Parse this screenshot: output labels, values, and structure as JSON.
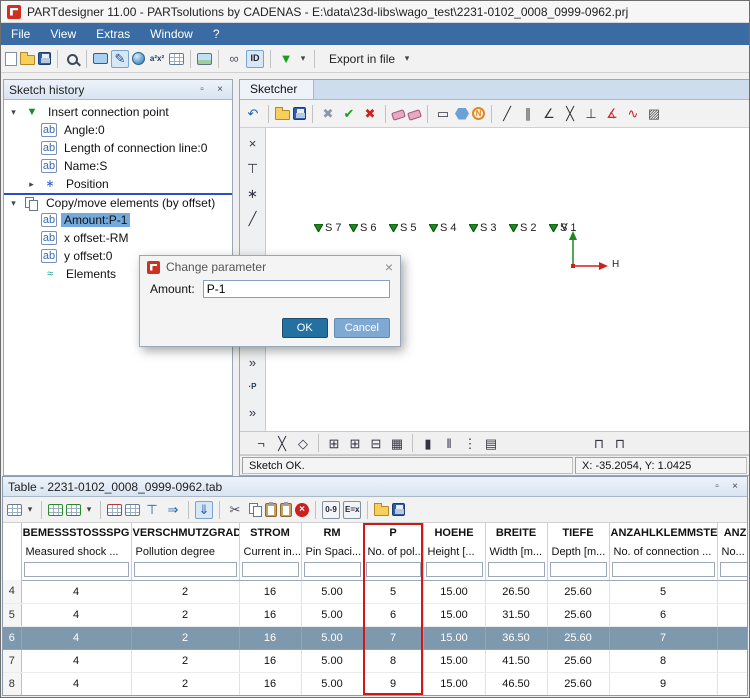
{
  "titlebar": {
    "title": "PARTdesigner 11.00 - PARTsolutions by CADENAS - E:\\data\\23d-libs\\wago_test\\2231-0102_0008_0999-0962.prj"
  },
  "menubar": {
    "items": [
      "File",
      "View",
      "Extras",
      "Window",
      "?"
    ]
  },
  "main_toolbar": {
    "icons": [
      "new-document",
      "open-project",
      "save-project",
      "|",
      "zoom-preview",
      "|",
      "copy-view",
      "sketcher-mode",
      "solid-view",
      "variable-list",
      "table-view",
      "|",
      "preview-image",
      "|",
      "link-parts",
      "id-display",
      "|",
      "status-flag",
      "dropdown-arrow",
      "|"
    ],
    "export_button": "Export in file"
  },
  "sketch_history": {
    "title": "Sketch history",
    "nodes": [
      {
        "label": "Insert connection point",
        "icon": "connection-point",
        "expanded": true,
        "children": [
          {
            "label": "Angle:0",
            "icon": "param-field"
          },
          {
            "label": "Length of connection line:0",
            "icon": "param-field"
          },
          {
            "label": "Name:S",
            "icon": "param-field"
          },
          {
            "label": "Position",
            "icon": "position-marker",
            "collapsed": true
          }
        ]
      },
      {
        "label": "Copy/move elements (by offset)",
        "icon": "copy-move",
        "expanded": true,
        "separator_above": true,
        "children": [
          {
            "label": "Amount:P-1",
            "icon": "param-field",
            "selected": true
          },
          {
            "label": "x offset:-RM",
            "icon": "param-field"
          },
          {
            "label": "y offset:0",
            "icon": "param-field"
          },
          {
            "label": "Elements",
            "icon": "elements"
          }
        ]
      }
    ]
  },
  "sketcher": {
    "title": "Sketcher",
    "toolbar_icons": [
      "undo",
      "|",
      "open-sketch",
      "save-sketch",
      "|",
      "delete-selection",
      "accept-sketch",
      "discard-sketch",
      "|",
      "eraser",
      "eraser-elements",
      "|",
      "rectangle-tool",
      "polygon-tool",
      "spline-badge",
      "|",
      "line-tool",
      "parallel-lines-tool",
      "angle-tool",
      "cross-lines-tool",
      "perpendicular-tool",
      "measure-angle-tool",
      "polyline-tool",
      "hatch-tool"
    ],
    "left_toolbar_icons": [
      "construction-point",
      "tangent-point",
      "star-point",
      "slash-line",
      "~",
      "chevron-more-1",
      "chevron-more-2",
      "point-label",
      "chevron-more-3"
    ],
    "bottom_toolbar_icons": [
      "corner-marker",
      "cross-marker",
      "diamond-marker",
      "|",
      "grid-snap",
      "grid-show",
      "grid-minor",
      "grid-fill",
      "|",
      "single-column",
      "double-column",
      "triple-column",
      "panel-grid",
      "~",
      "profile-cap-1",
      "profile-cap-2"
    ],
    "points": [
      {
        "label": "S 7"
      },
      {
        "label": "S 6"
      },
      {
        "label": "S 5"
      },
      {
        "label": "S 4"
      },
      {
        "label": "S 3"
      },
      {
        "label": "S 2"
      },
      {
        "label": "S 1"
      }
    ],
    "axes": {
      "vertical": "V",
      "horizontal": "H"
    },
    "status": {
      "message": "Sketch OK.",
      "coordinates": "X: -35.2054, Y: 1.0425"
    }
  },
  "dialog": {
    "title": "Change parameter",
    "label": "Amount:",
    "value": "P-1",
    "ok": "OK",
    "cancel": "Cancel"
  },
  "table_panel": {
    "title": "Table - 2231-0102_0008_0999-0962.tab",
    "toolbar_icons": [
      "table-edit",
      "dropdown-arrow",
      "|",
      "insert-row",
      "insert-column",
      "dropdown-arrow",
      "|",
      "delete-cells",
      "transpose-table",
      "merge-cells",
      "transfer-right",
      "|",
      "transfer-down",
      "|",
      "cut",
      "copy",
      "paste",
      "paste-special",
      "delete-rows",
      "|",
      "digit-format",
      "value-format",
      "|",
      "open-table",
      "save-table"
    ],
    "columns": [
      {
        "name": "BEMESSSTOSSSPG",
        "desc": "Measured shock ..."
      },
      {
        "name": "VERSCHMUTZGRAD",
        "desc": "Pollution degree"
      },
      {
        "name": "STROM",
        "desc": "Current in..."
      },
      {
        "name": "RM",
        "desc": "Pin Spaci..."
      },
      {
        "name": "P",
        "desc": "No. of pol...",
        "highlighted": true
      },
      {
        "name": "HOEHE",
        "desc": "Height [..."
      },
      {
        "name": "BREITE",
        "desc": "Width [m..."
      },
      {
        "name": "TIEFE",
        "desc": "Depth [m..."
      },
      {
        "name": "ANZAHLKLEMMSTEL",
        "desc": "No. of connection ..."
      },
      {
        "name": "ANZ",
        "desc": "No..."
      }
    ],
    "rows": [
      {
        "num": "4",
        "cells": [
          "4",
          "2",
          "16",
          "5.00",
          "5",
          "15.00",
          "26.50",
          "25.60",
          "5",
          ""
        ]
      },
      {
        "num": "5",
        "cells": [
          "4",
          "2",
          "16",
          "5.00",
          "6",
          "15.00",
          "31.50",
          "25.60",
          "6",
          ""
        ]
      },
      {
        "num": "6",
        "selected": true,
        "cells": [
          "4",
          "2",
          "16",
          "5.00",
          "7",
          "15.00",
          "36.50",
          "25.60",
          "7",
          ""
        ]
      },
      {
        "num": "7",
        "cells": [
          "4",
          "2",
          "16",
          "5.00",
          "8",
          "15.00",
          "41.50",
          "25.60",
          "8",
          ""
        ]
      },
      {
        "num": "8",
        "cells": [
          "4",
          "2",
          "16",
          "5.00",
          "9",
          "15.00",
          "46.50",
          "25.60",
          "9",
          ""
        ]
      }
    ]
  },
  "colors": {
    "menu_bar": "#3a6ca3",
    "tree_selection": "#74a9dc",
    "row_selection": "#7e98ad",
    "column_highlight": "#d01818",
    "point_marker": "#1c8a1c",
    "axis_v": "#1c8a1c",
    "axis_h": "#cc2222",
    "ok_button": "#2470a0",
    "cancel_button": "#7fa9d2"
  }
}
